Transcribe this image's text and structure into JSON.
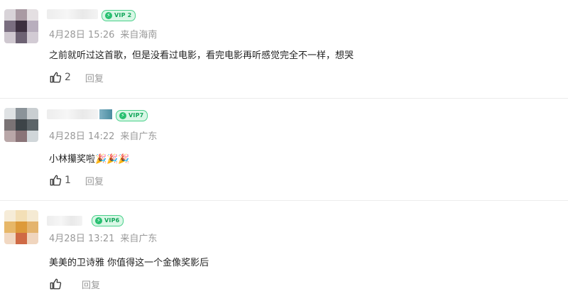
{
  "comments": [
    {
      "username": "",
      "vip_label": "VIP 2",
      "date": "4月28日 15:26",
      "location": "来自海南",
      "text": "之前就听过这首歌，但是没看过电影，看完电影再听感觉完全不一样，想哭",
      "like_count": "2",
      "reply_label": "回复",
      "avatar_colors": [
        "#d8d3d8",
        "#a99aa3",
        "#e4dfe2",
        "#7a6e80",
        "#3c2f3f",
        "#b8aebd",
        "#cfc8d0",
        "#6d6273",
        "#d2cbd4"
      ]
    },
    {
      "username": "",
      "vip_label": "VIP7",
      "date": "4月28日 14:22",
      "location": "来自广东",
      "text": "小林攥奖啦🎉🎉🎉",
      "like_count": "1",
      "reply_label": "回复",
      "avatar_colors": [
        "#dfe2e4",
        "#8b9399",
        "#c9ced1",
        "#7a7375",
        "#3d4448",
        "#5c6468",
        "#b9a7a8",
        "#8a7478",
        "#d0d6d9"
      ]
    },
    {
      "username": "",
      "vip_label": "VIP6",
      "date": "4月28日 13:21",
      "location": "来自广东",
      "text": "美美的卫诗雅 你值得这一个金像奖影后",
      "like_count": "",
      "reply_label": "回复",
      "avatar_colors": [
        "#f6ecd8",
        "#f3dfb6",
        "#f5ead3",
        "#e7b768",
        "#dd9a3a",
        "#e4b46e",
        "#f1d8c2",
        "#cf6a45",
        "#f0d5be"
      ]
    }
  ],
  "colors": {
    "vip_green": "#12a55a",
    "meta_gray": "#999999",
    "reply_gray": "#9a9a9a"
  },
  "icons": {
    "like": "thumbs-up-icon",
    "vip": "lightning-bolt-icon"
  }
}
